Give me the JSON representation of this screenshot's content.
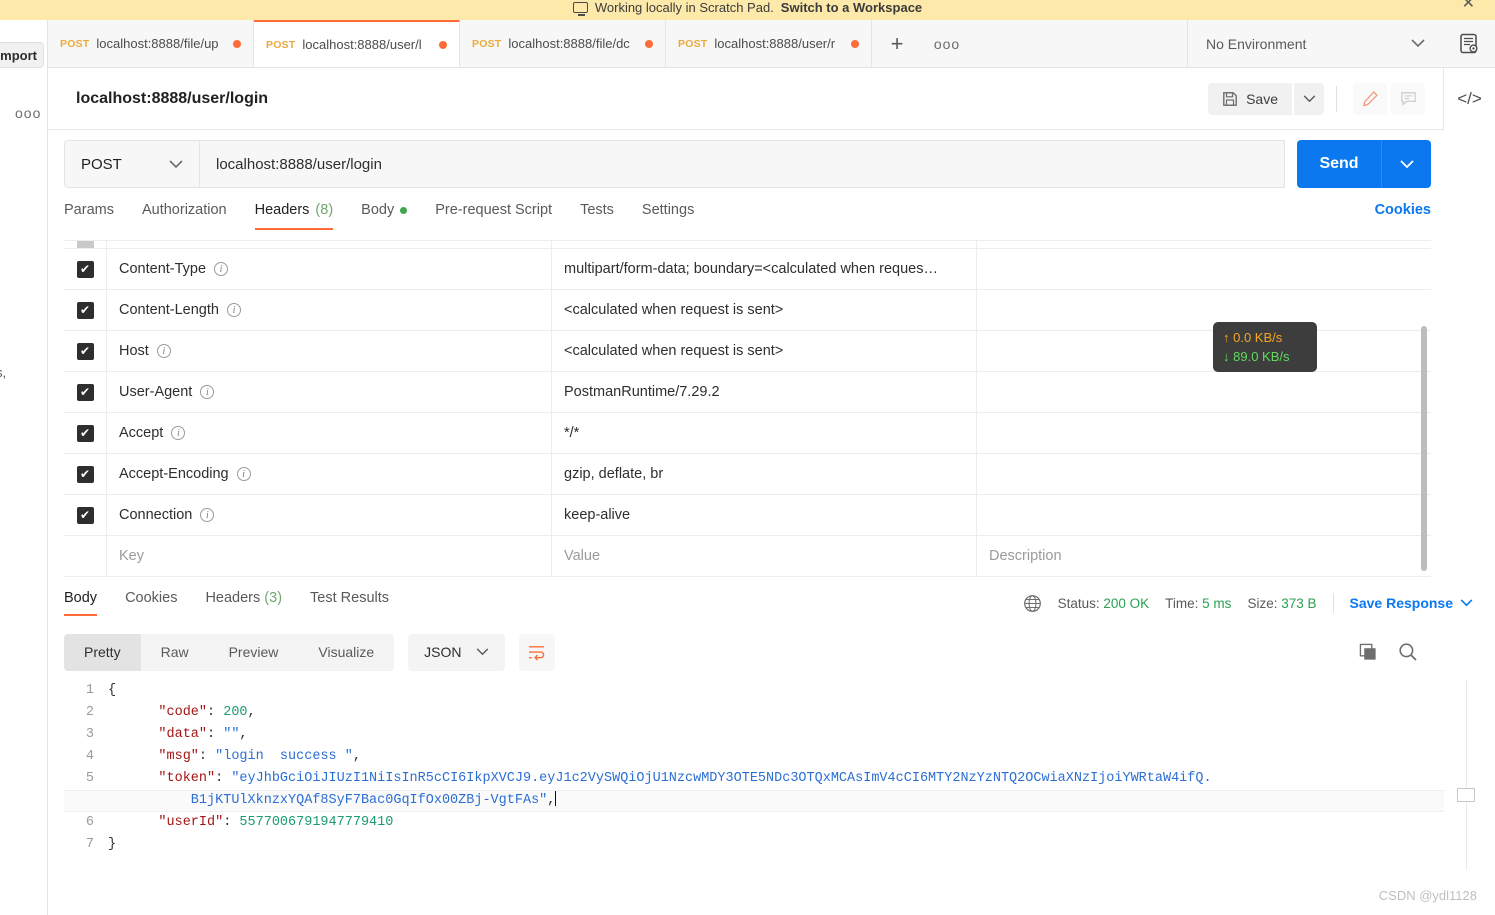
{
  "banner": {
    "text": "Working locally in Scratch Pad.",
    "link": "Switch to a Workspace",
    "close": "✕",
    "monitor_icon": "monitor-icon"
  },
  "left_sidebar": {
    "import_label": "Import",
    "more_dots": "ooo",
    "ghost_text": "s,"
  },
  "tabbar": {
    "tabs": [
      {
        "method": "POST",
        "name": "localhost:8888/file/up",
        "unsaved": true,
        "active": false
      },
      {
        "method": "POST",
        "name": "localhost:8888/user/l",
        "unsaved": true,
        "active": true
      },
      {
        "method": "POST",
        "name": "localhost:8888/file/dc",
        "unsaved": true,
        "active": false
      },
      {
        "method": "POST",
        "name": "localhost:8888/user/r",
        "unsaved": true,
        "active": false
      }
    ],
    "new_tab": "+",
    "tab_menu": "ooo",
    "environment": "No Environment",
    "env_caret": "chevron-down-icon",
    "env_quick_look": "environment-quick-look-icon"
  },
  "namebar": {
    "request_name": "localhost:8888/user/login",
    "save_label": "Save",
    "save_caret": "chevron-down-icon",
    "edit_icon": "pencil-icon",
    "comment_icon": "comment-icon",
    "code_icon": "</>"
  },
  "urlrow": {
    "method": "POST",
    "method_caret": "chevron-down-icon",
    "url": "localhost:8888/user/login",
    "send_label": "Send",
    "send_caret": "chevron-down-icon"
  },
  "request_tabs": {
    "items": [
      {
        "label": "Params",
        "badge": "",
        "dot": false,
        "active": false
      },
      {
        "label": "Authorization",
        "badge": "",
        "dot": false,
        "active": false
      },
      {
        "label": "Headers",
        "badge": "(8)",
        "dot": false,
        "active": true
      },
      {
        "label": "Body",
        "badge": "",
        "dot": true,
        "active": false
      },
      {
        "label": "Pre-request Script",
        "badge": "",
        "dot": false,
        "active": false
      },
      {
        "label": "Tests",
        "badge": "",
        "dot": false,
        "active": false
      },
      {
        "label": "Settings",
        "badge": "",
        "dot": false,
        "active": false
      }
    ],
    "cookies_link": "Cookies"
  },
  "headers_table": {
    "check_mark": "✔",
    "info_icon": "i",
    "rows": [
      {
        "key": "Content-Type",
        "value": "multipart/form-data; boundary=<calculated when reques…",
        "description": "",
        "checked": true
      },
      {
        "key": "Content-Length",
        "value": "<calculated when request is sent>",
        "description": "",
        "checked": true
      },
      {
        "key": "Host",
        "value": "<calculated when request is sent>",
        "description": "",
        "checked": true
      },
      {
        "key": "User-Agent",
        "value": "PostmanRuntime/7.29.2",
        "description": "",
        "checked": true
      },
      {
        "key": "Accept",
        "value": "*/*",
        "description": "",
        "checked": true
      },
      {
        "key": "Accept-Encoding",
        "value": "gzip, deflate, br",
        "description": "",
        "checked": true
      },
      {
        "key": "Connection",
        "value": "keep-alive",
        "description": "",
        "checked": true
      }
    ],
    "placeholder_row": {
      "key": "Key",
      "value": "Value",
      "description": "Description"
    }
  },
  "network_tooltip": {
    "up_arrow": "↑",
    "up_rate": "0.0 KB/s",
    "down_arrow": "↓",
    "down_rate": "89.0 KB/s"
  },
  "response": {
    "tabs": [
      {
        "label": "Body",
        "badge": "",
        "active": true
      },
      {
        "label": "Cookies",
        "badge": "",
        "active": false
      },
      {
        "label": "Headers",
        "badge": "(3)",
        "active": false
      },
      {
        "label": "Test Results",
        "badge": "",
        "active": false
      }
    ],
    "globe_icon": "globe-icon",
    "status_label": "Status:",
    "status_value": "200 OK",
    "time_label": "Time:",
    "time_value": "5 ms",
    "size_label": "Size:",
    "size_value": "373 B",
    "save_response": "Save Response",
    "save_response_caret": "chevron-down-icon",
    "view_modes": [
      "Pretty",
      "Raw",
      "Preview",
      "Visualize"
    ],
    "active_view": "Pretty",
    "format": "JSON",
    "format_caret": "chevron-down-icon",
    "wrap_icon": "wrap-lines-icon",
    "copy_icon": "copy-icon",
    "search_icon": "search-icon"
  },
  "code_view": {
    "lines": [
      {
        "no": "1",
        "fold": "{",
        "segments": []
      },
      {
        "no": "2",
        "fold": "",
        "segments": [
          {
            "cls": "k",
            "t": "    \"code\""
          },
          {
            "cls": "p",
            "t": ": "
          },
          {
            "cls": "n",
            "t": "200"
          },
          {
            "cls": "p",
            "t": ","
          }
        ]
      },
      {
        "no": "3",
        "fold": "",
        "segments": [
          {
            "cls": "k",
            "t": "    \"data\""
          },
          {
            "cls": "p",
            "t": ": "
          },
          {
            "cls": "s",
            "t": "\"\""
          },
          {
            "cls": "p",
            "t": ","
          }
        ]
      },
      {
        "no": "4",
        "fold": "",
        "segments": [
          {
            "cls": "k",
            "t": "    \"msg\""
          },
          {
            "cls": "p",
            "t": ": "
          },
          {
            "cls": "s",
            "t": "\"login  success \""
          },
          {
            "cls": "p",
            "t": ","
          }
        ]
      },
      {
        "no": "5",
        "fold": "",
        "segments": [
          {
            "cls": "k",
            "t": "    \"token\""
          },
          {
            "cls": "p",
            "t": ": "
          },
          {
            "cls": "s",
            "t": "\"eyJhbGciOiJIUzI1NiIsInR5cCI6IkpXVCJ9.eyJ1c2VySWQiOjU1NzcwMDY3OTE5NDc3OTQxMCAsImV4cCI6MTY2NzYzNTQ2OCwiaXNzIjoiYWRtaW4ifQ."
          }
        ]
      },
      {
        "no": "",
        "fold": "",
        "wrapped": true,
        "segments": [
          {
            "cls": "s",
            "t": "        B1jKTUlXknzxYQAf8SyF7Bac0GqIfOx00ZBj-VgtFAs\""
          },
          {
            "cls": "p",
            "t": ","
          }
        ]
      },
      {
        "no": "6",
        "fold": "",
        "segments": [
          {
            "cls": "k",
            "t": "    \"userId\""
          },
          {
            "cls": "p",
            "t": ": "
          },
          {
            "cls": "n",
            "t": "5577006791947779410"
          }
        ]
      },
      {
        "no": "7",
        "fold": "}",
        "segments": []
      }
    ]
  },
  "watermark": "CSDN @ydl1128",
  "colors": {
    "accent_orange": "#ff6c37",
    "send_blue": "#0b78f0",
    "banner_yellow": "#fde9a9",
    "status_green": "#2aa14f",
    "method_post": "#ebaa3b"
  }
}
